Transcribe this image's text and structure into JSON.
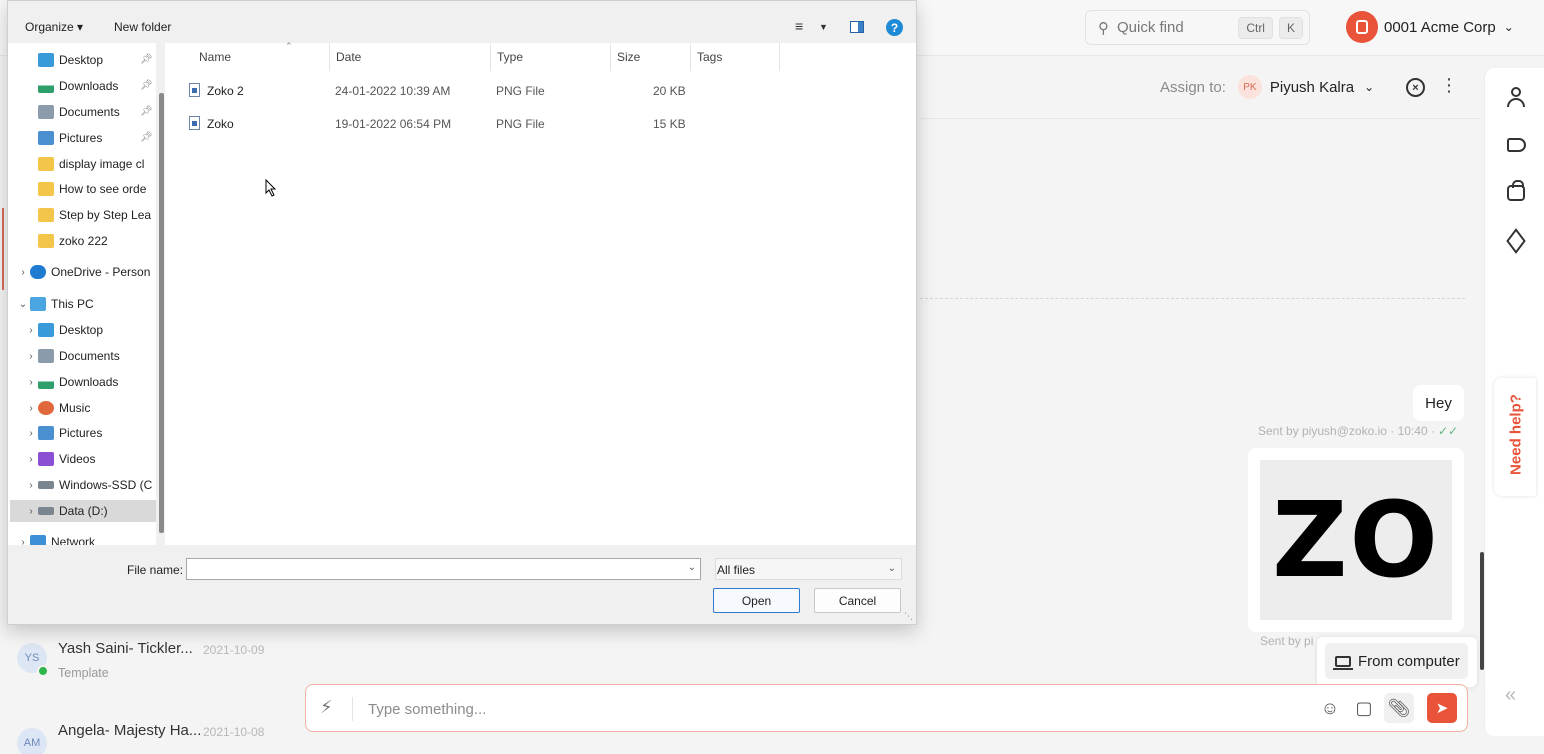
{
  "app": {
    "quick_find": {
      "label": "Quick find",
      "key1": "Ctrl",
      "key2": "K"
    },
    "org_name": "0001 Acme Corp",
    "assign": {
      "label": "Assign to:",
      "initials": "PK",
      "name": "Piyush Kalra"
    },
    "messages": {
      "hey": "Hey",
      "hey_meta": "Sent by piyush@zoko.io · 10:40 ·",
      "hey_ticks": "✓✓",
      "image_text": "ZO",
      "image_meta": "Sent by pi"
    },
    "attach_menu": {
      "from_computer": "From computer"
    },
    "composer": {
      "placeholder": "Type something..."
    },
    "need_help": "Need help?",
    "conversations": [
      {
        "initials": "YS",
        "name": "Yash Saini- Tickler...",
        "date": "2021-10-09",
        "sub": "Template"
      },
      {
        "initials": "AM",
        "name": "Angela- Majesty Ha...",
        "date": "2021-10-08",
        "sub": ""
      }
    ],
    "colors": {
      "accent": "#e8533a",
      "whatsapp": "#2fb54a"
    }
  },
  "dialog": {
    "toolbar": {
      "organize": "Organize ▾",
      "new_folder": "New folder"
    },
    "nav": [
      {
        "label": "Desktop",
        "pinned": true,
        "icon": "desktop"
      },
      {
        "label": "Downloads",
        "pinned": true,
        "icon": "downloads"
      },
      {
        "label": "Documents",
        "pinned": true,
        "icon": "documents"
      },
      {
        "label": "Pictures",
        "pinned": true,
        "icon": "pictures"
      },
      {
        "label": "display image cl",
        "icon": "folder"
      },
      {
        "label": "How to see orde",
        "icon": "folder"
      },
      {
        "label": "Step by Step Lea",
        "icon": "folder"
      },
      {
        "label": "zoko 222",
        "icon": "folder"
      },
      {
        "label": "OneDrive - Person",
        "icon": "onedrive"
      },
      {
        "label": "This PC",
        "icon": "pc"
      },
      {
        "label": "Desktop",
        "icon": "desktop"
      },
      {
        "label": "Documents",
        "icon": "documents"
      },
      {
        "label": "Downloads",
        "icon": "downloads"
      },
      {
        "label": "Music",
        "icon": "music"
      },
      {
        "label": "Pictures",
        "icon": "pictures"
      },
      {
        "label": "Videos",
        "icon": "videos"
      },
      {
        "label": "Windows-SSD (C",
        "icon": "drive"
      },
      {
        "label": "Data (D:)",
        "icon": "drive",
        "selected": true
      },
      {
        "label": "Network",
        "icon": "network"
      }
    ],
    "columns": [
      "Name",
      "Date",
      "Type",
      "Size",
      "Tags"
    ],
    "files": [
      {
        "name": "Zoko 2",
        "date": "24-01-2022 10:39 AM",
        "type": "PNG File",
        "size": "20 KB"
      },
      {
        "name": "Zoko",
        "date": "19-01-2022 06:54 PM",
        "type": "PNG File",
        "size": "15 KB"
      }
    ],
    "file_name_label": "File name:",
    "file_name_value": "",
    "filter": "All files",
    "open_label": "Open",
    "cancel_label": "Cancel"
  }
}
